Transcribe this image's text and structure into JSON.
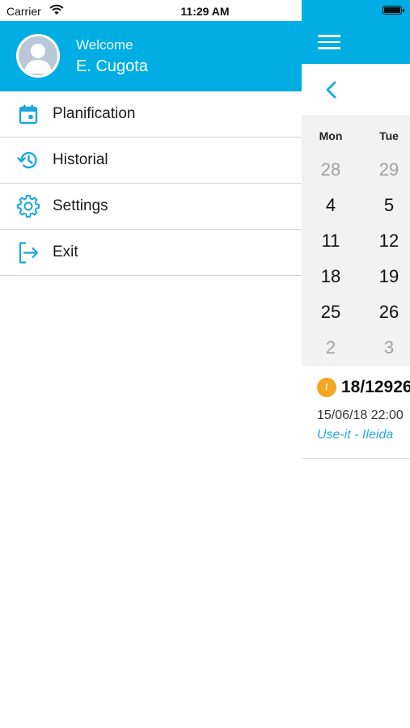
{
  "status_bar": {
    "carrier": "Carrier",
    "time": "11:29 AM"
  },
  "drawer": {
    "welcome": "Welcome",
    "username": "E. Cugota",
    "menu": [
      {
        "label": "Planification",
        "icon": "calendar-icon"
      },
      {
        "label": "Historial",
        "icon": "history-icon"
      },
      {
        "label": "Settings",
        "icon": "gear-icon"
      },
      {
        "label": "Exit",
        "icon": "exit-icon"
      }
    ]
  },
  "calendar": {
    "weekdays": [
      "Mon",
      "Tue"
    ],
    "weeks": [
      [
        "28",
        "29"
      ],
      [
        "4",
        "5"
      ],
      [
        "11",
        "12"
      ],
      [
        "18",
        "19"
      ],
      [
        "25",
        "26"
      ],
      [
        "2",
        "3"
      ]
    ]
  },
  "event": {
    "id": "18/12926",
    "datetime": "15/06/18 22:00",
    "location": "Use-it - Ileida"
  },
  "colors": {
    "accent": "#00AEE3",
    "badge": "#F5A623",
    "link": "#29A8DA"
  }
}
